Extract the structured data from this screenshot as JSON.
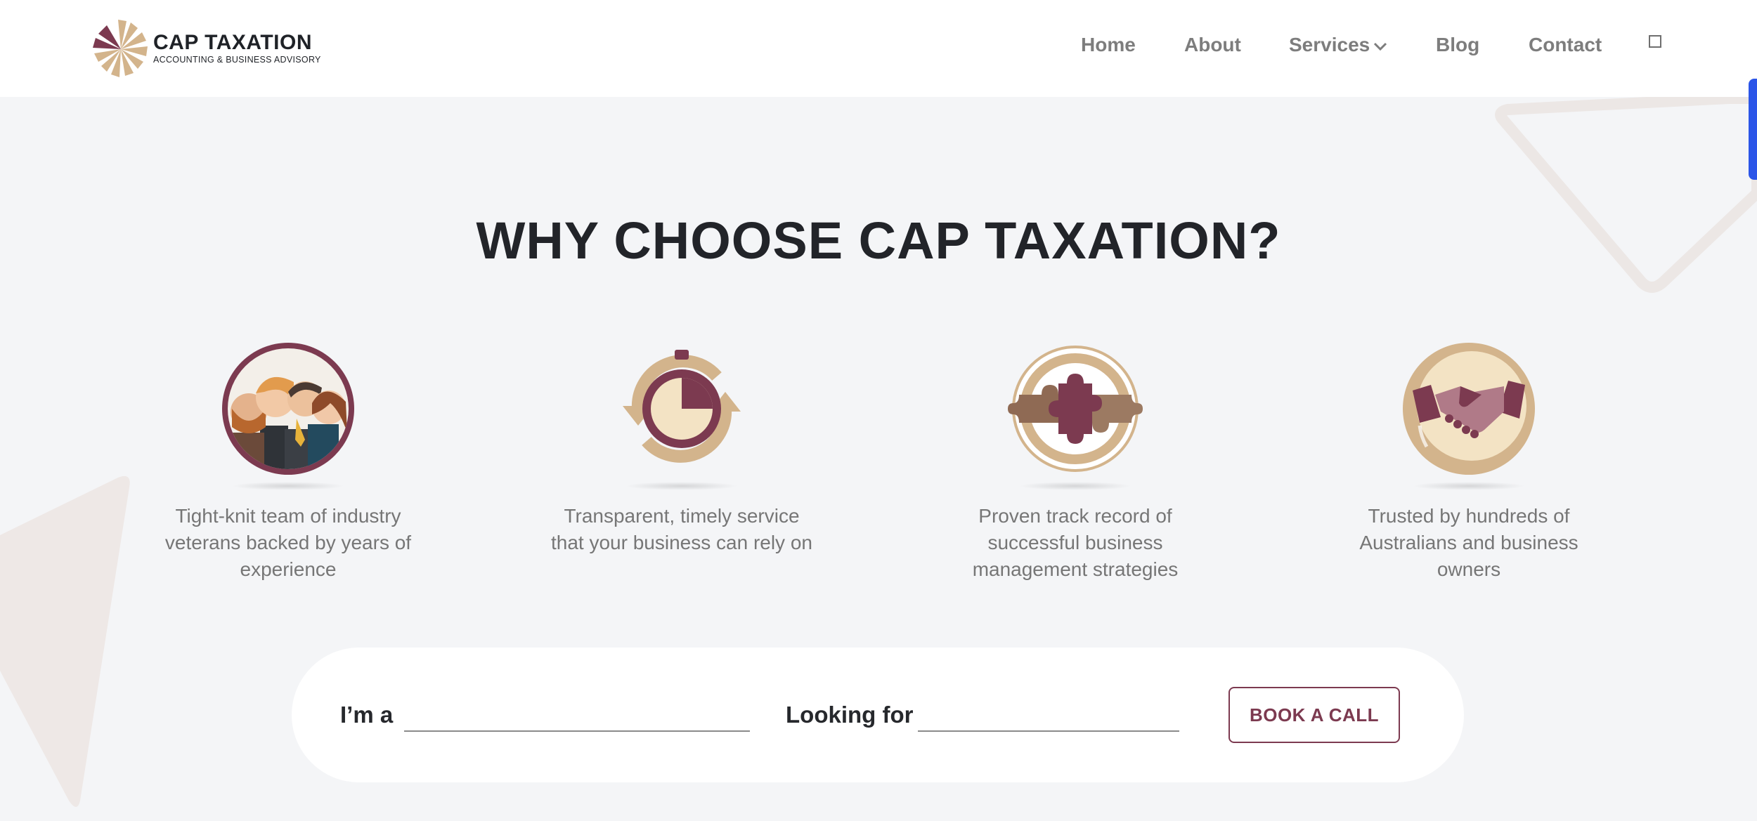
{
  "brand": {
    "name": "CAP TAXATION",
    "tagline": "ACCOUNTING  & BUSINESS ADVISORY"
  },
  "nav": {
    "items": [
      {
        "label": "Home"
      },
      {
        "label": "About"
      },
      {
        "label": "Services"
      },
      {
        "label": "Blog"
      },
      {
        "label": "Contact"
      }
    ]
  },
  "section": {
    "title": "WHY CHOOSE CAP TAXATION?"
  },
  "features": [
    {
      "icon": "team-icon",
      "caption": "Tight-knit team of industry veterans backed by years of experience"
    },
    {
      "icon": "stopwatch-icon",
      "caption": "Transparent, timely service that your business can rely on"
    },
    {
      "icon": "puzzle-icon",
      "caption": "Proven track record of successful business management strategies"
    },
    {
      "icon": "handshake-icon",
      "caption": "Trusted by hundreds of Australians and business owners"
    }
  ],
  "form": {
    "im_a_label": "I’m a",
    "im_a_value": "",
    "looking_for_label": "Looking for",
    "looking_for_value": "",
    "cta_label": "BOOK A CALL"
  },
  "colors": {
    "brand_maroon": "#7c3a50",
    "brand_tan": "#d3b48c",
    "background": "#f4f5f7",
    "scroll_tab": "#2b55e8"
  }
}
